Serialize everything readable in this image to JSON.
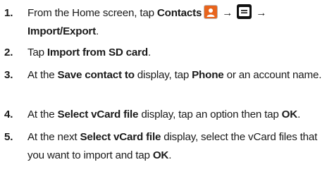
{
  "steps": [
    {
      "number": "1.",
      "pre": "From the Home screen, tap ",
      "b1": "Contacts",
      "arrow1": "→",
      "arrow2": "→",
      "b2": "Import/Export",
      "end": "."
    },
    {
      "number": "2.",
      "pre": "Tap ",
      "b1": "Import from SD card",
      "end": "."
    },
    {
      "number": "3.",
      "pre": "At the ",
      "b1": "Save contact to",
      "mid1": " display, tap ",
      "b2": "Phone",
      "end": " or an account name."
    },
    {
      "number": "4.",
      "pre": "At the ",
      "b1": "Select vCard file",
      "mid1": " display, tap an option then tap ",
      "b2": "OK",
      "end": "."
    },
    {
      "number": "5.",
      "pre": "At the next ",
      "b1": "Select vCard file",
      "mid1": " display, select the vCard files that you want to import and tap ",
      "b2": "OK",
      "end": "."
    }
  ],
  "icons": {
    "contacts": "contacts-icon",
    "menu": "menu-icon"
  },
  "colors": {
    "contacts_icon": "#e8641c",
    "menu_icon": "#111111"
  }
}
